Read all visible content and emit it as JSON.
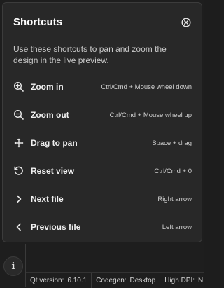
{
  "panel": {
    "title": "Shortcuts",
    "description": "Use these shortcuts to pan and zoom the design in the live preview.",
    "close_icon": "close-circle-icon"
  },
  "shortcuts": [
    {
      "icon": "zoom-in-icon",
      "label": "Zoom in",
      "keys": "Ctrl/Cmd + Mouse wheel down"
    },
    {
      "icon": "zoom-out-icon",
      "label": "Zoom out",
      "keys": "Ctrl/Cmd + Mouse wheel up"
    },
    {
      "icon": "move-arrows-icon",
      "label": "Drag to pan",
      "keys": "Space + drag"
    },
    {
      "icon": "reset-view-icon",
      "label": "Reset view",
      "keys": "Ctrl/Cmd + 0"
    },
    {
      "icon": "chevron-right-icon",
      "label": "Next file",
      "keys": "Right arrow"
    },
    {
      "icon": "chevron-left-icon",
      "label": "Previous file",
      "keys": "Left arrow"
    }
  ],
  "info_button": {
    "glyph": "i"
  },
  "status_bar": {
    "qt_version_label": "Qt version:",
    "qt_version_value": "6.10.1",
    "codegen_label": "Codegen:",
    "codegen_value": "Desktop",
    "high_dpi_label": "High DPI:",
    "high_dpi_value": "N"
  },
  "colors": {
    "panel_bg": "#282828",
    "app_bg": "#1e1e1e",
    "text": "#f0f0f0"
  }
}
